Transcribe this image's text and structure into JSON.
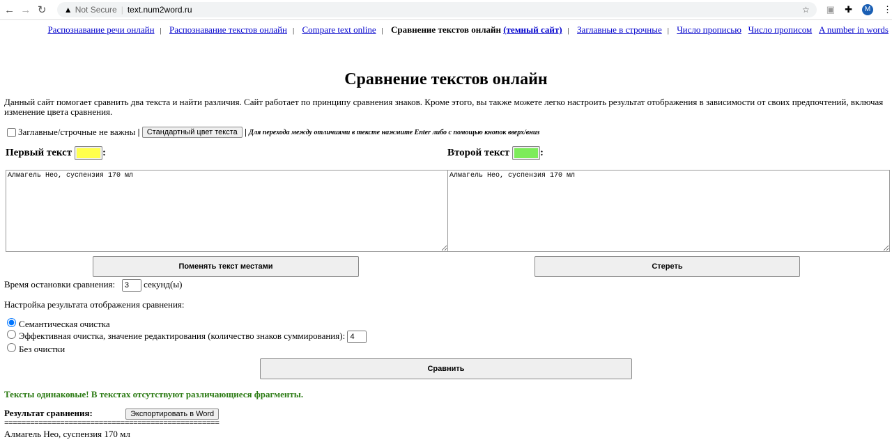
{
  "browser": {
    "security": "Not Secure",
    "url": "text.num2word.ru",
    "avatar": "M"
  },
  "nav": {
    "links": [
      "Распознавание речи онлайн",
      "Распознавание текстов онлайн",
      "Compare text online"
    ],
    "current": "Сравнение текстов онлайн",
    "dark_link": "(темный сайт)",
    "links2": [
      "Заглавные в строчные"
    ],
    "links3": [
      "Число прописью",
      "Число прописом",
      "A number in words"
    ],
    "separator": "|"
  },
  "title": "Сравнение текстов онлайн",
  "description": "Данный сайт помогает сравнить два текста и найти различия. Сайт работает по принципу сравнения знаков. Кроме этого, вы также можете легко настроить результат отображения в зависимости от своих предпочтений, включая изменение цвета сравнения.",
  "options": {
    "case_label": "Заглавные/строчные не важны",
    "sep": "|",
    "default_color_btn": "Стандартный цвет текста",
    "hint": "Для перехода между отличиями в тексте нажмите Enter либо с помощью кнопок вверх/вниз"
  },
  "first": {
    "label": "Первый текст",
    "colon": ":",
    "color": "#ffff4d",
    "text": "Алмагель Нео, суспензия 170 мл"
  },
  "second": {
    "label": "Второй текст",
    "colon": ":",
    "color": "#7dec5a",
    "text": "Алмагель Нео, суспензия 170 мл"
  },
  "swap_btn": "Поменять текст местами",
  "clear_btn": "Стереть",
  "timeout": {
    "label": "Время остановки сравнения:",
    "value": "3",
    "unit": "секунд(ы)"
  },
  "settings_label": "Настройка результата отображения сравнения:",
  "radios": [
    {
      "label": "Семантическая очистка",
      "checked": true
    },
    {
      "label": "Эффективная очистка, значение редактирования (количество знаков суммирования):",
      "value": "4"
    },
    {
      "label": "Без очистки"
    }
  ],
  "compare_btn": "Сравнить",
  "status": "Тексты одинаковые! В текстах отсутствуют различающиеся фрагменты.",
  "result_label": "Результат сравнения:",
  "export_btn": "Экспортировать в Word",
  "divider": "==================================================",
  "result_text": "Алмагель Нео, суспензия 170 мл"
}
